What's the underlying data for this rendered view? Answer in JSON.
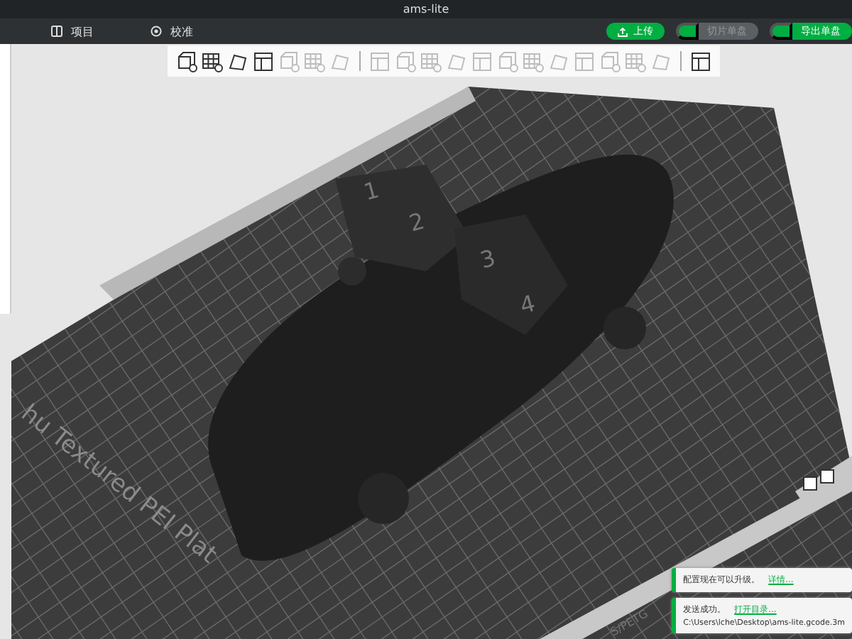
{
  "window": {
    "title": "ams-lite"
  },
  "tabs": [
    {
      "label": "项目",
      "selected": false
    },
    {
      "label": "校准",
      "selected": false
    }
  ],
  "actions": [
    {
      "label": "上传",
      "disabled": false
    },
    {
      "label": "切片单盘",
      "disabled": true
    },
    {
      "label": "导出单盘",
      "disabled": false
    }
  ],
  "toolbar": [
    {
      "kind": "icon",
      "disabled": false
    },
    {
      "kind": "icon",
      "disabled": false
    },
    {
      "kind": "icon",
      "disabled": false
    },
    {
      "kind": "icon",
      "disabled": false
    },
    {
      "kind": "icon",
      "disabled": true
    },
    {
      "kind": "icon",
      "disabled": true
    },
    {
      "kind": "icon",
      "disabled": true
    },
    {
      "kind": "separator"
    },
    {
      "kind": "icon",
      "disabled": true
    },
    {
      "kind": "icon",
      "disabled": true
    },
    {
      "kind": "icon",
      "disabled": true
    },
    {
      "kind": "icon",
      "disabled": true
    },
    {
      "kind": "icon",
      "disabled": true
    },
    {
      "kind": "icon",
      "disabled": true
    },
    {
      "kind": "icon",
      "disabled": true
    },
    {
      "kind": "icon",
      "disabled": true
    },
    {
      "kind": "icon",
      "disabled": true
    },
    {
      "kind": "icon",
      "disabled": true
    },
    {
      "kind": "icon",
      "disabled": true
    },
    {
      "kind": "icon",
      "disabled": true
    },
    {
      "kind": "separator"
    },
    {
      "kind": "icon",
      "disabled": false
    }
  ],
  "viewport": {
    "plate_label": "hu Textured PEI Plat",
    "filament_label": "S/PETG",
    "model_labels": [
      "1",
      "2",
      "3",
      "4"
    ]
  },
  "notifications": [
    {
      "text": "配置现在可以升级。",
      "link": "详情..."
    },
    {
      "text": "发送成功。",
      "link": "打开目录...",
      "path": "C:\\Users\\lche\\Desktop\\ams-lite.gcode.3m"
    }
  ]
}
